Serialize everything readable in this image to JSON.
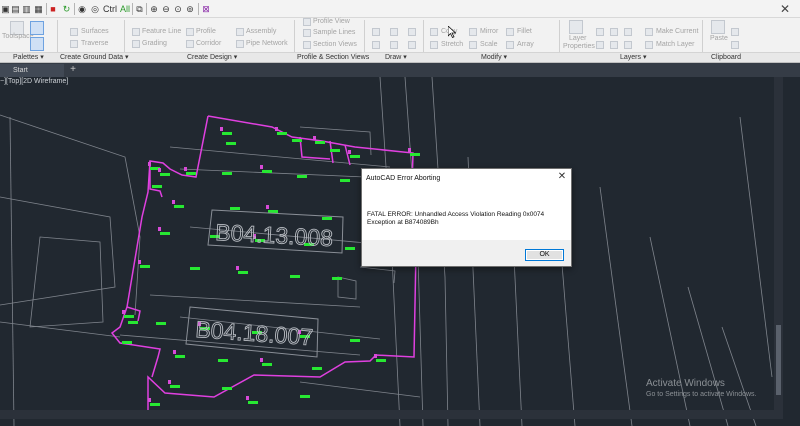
{
  "quick_access": {
    "ctrl_label": "Ctrl",
    "all_label": "All"
  },
  "ribbon": {
    "texts": {
      "workspace": "Toolspace",
      "surfaces": "Surfaces",
      "traverse": "Traverse",
      "feature_line": "Feature Line",
      "grading": "Grading",
      "profile": "Profile",
      "corridor": "Corridor",
      "assembly": "Assembly",
      "pipe_network": "Pipe Network",
      "profile_view": "Profile View",
      "sample_lines": "Sample Lines",
      "section_views": "Section Views",
      "copy": "Copy",
      "stretch": "Stretch",
      "mirror": "Mirror",
      "scale": "Scale",
      "fillet": "Fillet",
      "array": "Array",
      "layer": "Layer",
      "properties": "Properties",
      "make_current": "Make Current",
      "match_layer": "Match Layer",
      "paste": "Paste"
    }
  },
  "panels": [
    {
      "label": "Palettes ▾"
    },
    {
      "label": "Create Ground Data ▾"
    },
    {
      "label": "Create Design ▾"
    },
    {
      "label": "Profile & Section Views"
    },
    {
      "label": "Draw ▾"
    },
    {
      "label": "Modify ▾"
    },
    {
      "label": "Layers ▾"
    },
    {
      "label": "Clipboard"
    }
  ],
  "tabs": {
    "start": "Start",
    "add": "+"
  },
  "viewport": {
    "label": "−][Top][2D Wireframe]",
    "parcel_labels": [
      "B04.13.008",
      "B04.18.007"
    ]
  },
  "dialog": {
    "title": "AutoCAD Error Aborting",
    "close": "✕",
    "message": "FATAL ERROR:  Unhandled Access Violation Reading 0x0074 Exception at B874089Bh",
    "ok_label": "OK"
  },
  "watermark": {
    "title": "Activate Windows",
    "subtitle": "Go to Settings to activate Windows."
  },
  "colors": {
    "canvas": "#212830",
    "boundary": "#e040e0",
    "points": "#27e832",
    "linework": "#8a8f97",
    "dialog_accent": "#0078d7"
  }
}
